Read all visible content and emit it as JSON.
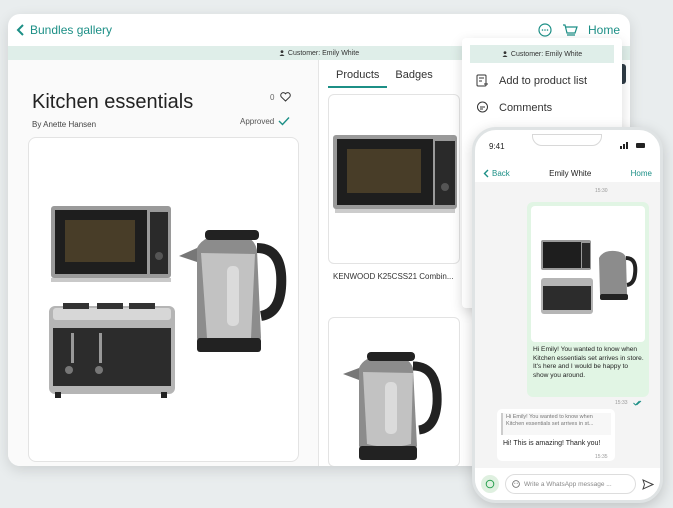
{
  "header": {
    "back_label": "Bundles gallery",
    "home_label": "Home"
  },
  "customer_bar": {
    "text": "Customer: Emily White"
  },
  "bundle": {
    "title": "Kitchen essentials",
    "author": "By Anette Hansen",
    "likes": "0",
    "status": "Approved"
  },
  "tabs": [
    {
      "label": "Products"
    },
    {
      "label": "Badges"
    }
  ],
  "products": [
    {
      "name": "KENWOOD K25CSS21 Combin..."
    }
  ],
  "dropdown": {
    "header": "Customer: Emily White",
    "items": [
      {
        "label": "Add to product list",
        "icon": "add-to-list-icon"
      },
      {
        "label": "Comments",
        "icon": "comment-icon"
      }
    ]
  },
  "phone": {
    "time": "9:41",
    "back_label": "Back",
    "contact": "Emily White",
    "home_label": "Home",
    "timestamp_top": "15:30",
    "outgoing_text": "Hi Emily! You wanted to know when Kitchen essentials set arrives in store. It's here and I would be happy to show you around.",
    "outgoing_time": "15:33",
    "quote_text": "Hi Emily! You wanted to know when Kitchen essentials set arrives in st...",
    "incoming_text": "Hi! This is amazing! Thank you!",
    "incoming_time": "15:35",
    "input_placeholder": "Write a WhatsApp message ..."
  },
  "colors": {
    "accent": "#1c8f86",
    "customer_bar": "#dfeee9",
    "outgoing_bubble": "#e1f5e4"
  }
}
